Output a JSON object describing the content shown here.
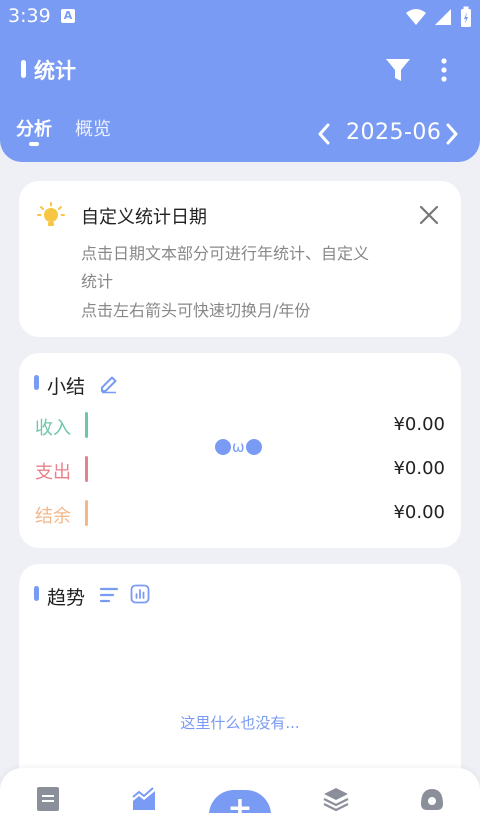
{
  "status_bar": {
    "time": "3:39",
    "notification_badge": "A"
  },
  "app_bar": {
    "title": "统计"
  },
  "tabs": [
    {
      "label": "分析",
      "active": true
    },
    {
      "label": "概览",
      "active": false
    }
  ],
  "period": {
    "value": "2025-06"
  },
  "tip_card": {
    "title": "自定义统计日期",
    "line1": "点击日期文本部分可进行年统计、自定义",
    "line2": "统计",
    "line3": "点击左右箭头可快速切换月/年份"
  },
  "summary": {
    "title": "小结",
    "rows": [
      {
        "label": "收入",
        "value": "¥0.00",
        "color": "#6cc7a8"
      },
      {
        "label": "支出",
        "value": "¥0.00",
        "color": "#e8828a"
      },
      {
        "label": "结余",
        "value": "¥0.00",
        "color": "#f3b78a"
      }
    ],
    "face": "ω"
  },
  "trend": {
    "title": "趋势",
    "empty_text": "这里什么也没有..."
  },
  "bottom_nav": {
    "add_label": "+"
  },
  "colors": {
    "primary": "#7a9bf3",
    "background": "#eef0f6"
  }
}
